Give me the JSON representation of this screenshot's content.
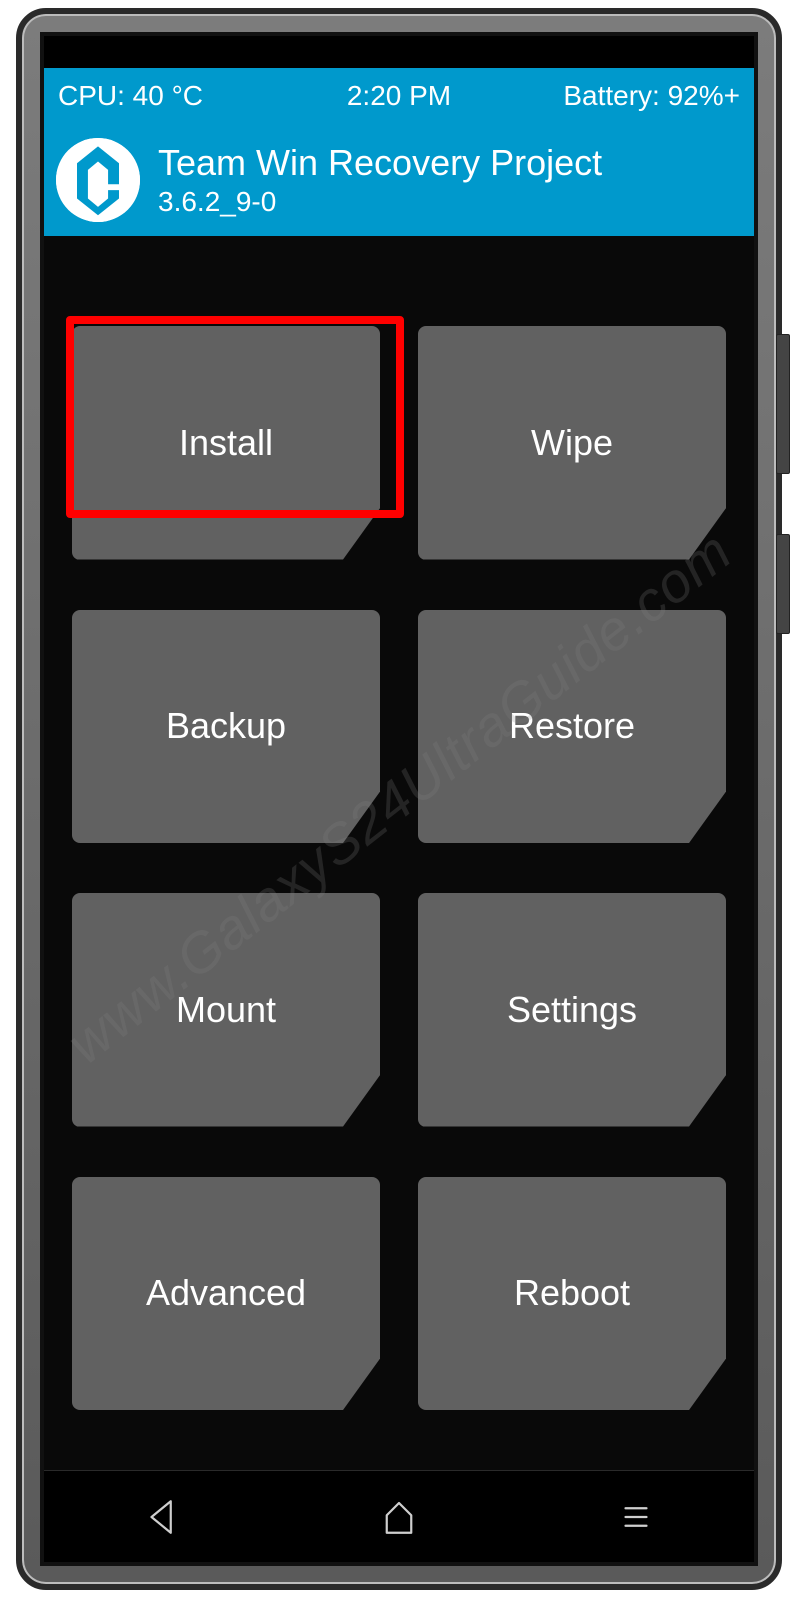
{
  "status_bar": {
    "cpu": "CPU: 40 °C",
    "time": "2:20 PM",
    "battery": "Battery: 92%+"
  },
  "header": {
    "title": "Team Win Recovery Project",
    "version": "3.6.2_9-0"
  },
  "menu": {
    "items": [
      {
        "label": "Install",
        "highlighted": true
      },
      {
        "label": "Wipe",
        "highlighted": false
      },
      {
        "label": "Backup",
        "highlighted": false
      },
      {
        "label": "Restore",
        "highlighted": false
      },
      {
        "label": "Mount",
        "highlighted": false
      },
      {
        "label": "Settings",
        "highlighted": false
      },
      {
        "label": "Advanced",
        "highlighted": false
      },
      {
        "label": "Reboot",
        "highlighted": false
      }
    ]
  },
  "watermark": "www.GalaxyS24UltraGuide.com",
  "colors": {
    "accent": "#0099cc",
    "button": "#616161",
    "highlight": "#ff0000"
  }
}
